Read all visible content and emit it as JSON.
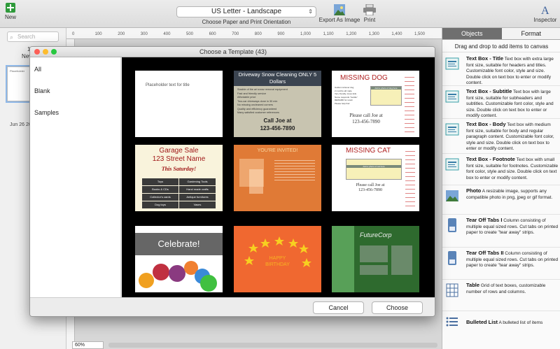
{
  "toolbar": {
    "new_label": "New",
    "paper_size": "US Letter - Landscape",
    "paper_caption": "Choose Paper and Print Orientation",
    "export_label": "Export As Image",
    "print_label": "Print",
    "inspector_label": "Inspector"
  },
  "left_panel": {
    "search_placeholder": "Search",
    "doc_count": "1 Do",
    "doc_name": "New Den",
    "thumb_text": "Placeholder",
    "date": "Jun 26 20"
  },
  "ruler": {
    "ticks": [
      "0",
      "100",
      "200",
      "300",
      "400",
      "500",
      "600",
      "700",
      "800",
      "900",
      "1,000",
      "1,100",
      "1,200",
      "1,300",
      "1,400",
      "1,500"
    ]
  },
  "zoom": "60%",
  "right_panel": {
    "tab_objects": "Objects",
    "tab_format": "Format",
    "hint": "Drag and drop to add items to canvas",
    "items": [
      {
        "title": "Text Box - Title",
        "desc": "Text box with extra large font size, suitable for headers and titles. Customizable font color, style and size.  Double click on text box to enter or modify content."
      },
      {
        "title": "Text Box - Subtitle",
        "desc": "Text box with large font size, suitable for subheaders and subtitles. Customizable font color, style and size.  Double click on text box to enter or modify content."
      },
      {
        "title": "Text Box - Body",
        "desc": "Text box with medium font size, suitable for body and regular paragraph content. Customizable font color, style and size. Double click on text box to enter or modify content."
      },
      {
        "title": "Text Box - Footnote",
        "desc": "Text box with small font size, suitable for footnotes. Customizable font color, style and size.  Double click on text box to enter or modify content."
      },
      {
        "title": "Photo",
        "desc": "A resizable image, supports any compatible photo in png, jpeg or gif format."
      },
      {
        "title": "Tear Off Tabs I",
        "desc": "Column consisting of multiple equal sized rows.  Cut tabs on printed paper to create \"tear away\" strips."
      },
      {
        "title": "Tear Off Tabs II",
        "desc": "Column consisting of multiple equal sized rows.  Cut tabs on printed paper to create \"tear away\" strips."
      },
      {
        "title": "Table",
        "desc": "Grid of text boxes, customizable number of rows and columns."
      },
      {
        "title": "Bulleted List",
        "desc": "A bulleted list of items"
      }
    ]
  },
  "dialog": {
    "title": "Choose a Template (43)",
    "categories": [
      "All",
      "Blank",
      "Samples"
    ],
    "cancel": "Cancel",
    "choose": "Choose",
    "templates": {
      "t1": {
        "text": "Placeholder text for title"
      },
      "t2": {
        "header": "Driveway Snow Cleaning ONLY 5 Dollars",
        "bullets": [
          "Sizable of the art snow removal equipment",
          "Fast and friendly service",
          "Affordable price",
          "Two-car driveways done in 30 min",
          "No missing uncleaned corners",
          "Quality and efficiency guaranteed",
          "Many satisfied customer references"
        ],
        "call": "Call Joe at",
        "phone": "123-456-7890"
      },
      "t3": {
        "title": "MISSING DOG",
        "photo": "Add a photo of dog here",
        "call": "Please call Joe at",
        "phone": "123-456-7890",
        "bullets": [
          "Golden retriever dog",
          "2 months old male",
          "Very friendly, loves kids",
          "Name responds \"Goldie\"",
          "REWARD for return",
          "Please help find"
        ]
      },
      "t4": {
        "line1": "Garage Sale",
        "line2": "123 Street Name",
        "line3": "This Saturday!",
        "cells": [
          "Toys",
          "Gardening Tools",
          "Books & CDs",
          "Hand made crafts",
          "Collector's cards",
          "Antique furnitures",
          "Dog toys",
          "Vases"
        ]
      },
      "t5": {
        "title": "YOU'RE INVITED!"
      },
      "t6": {
        "title": "MISSING CAT",
        "photo": "Add a photo of cat here",
        "call": "Please call Joe at",
        "phone": "123-456-7890"
      },
      "t7": {
        "title": "Celebrate!"
      },
      "t8": {
        "title": "HAPPY BIRTHDAY"
      },
      "t9": {
        "title": "FutureCorp"
      }
    }
  }
}
